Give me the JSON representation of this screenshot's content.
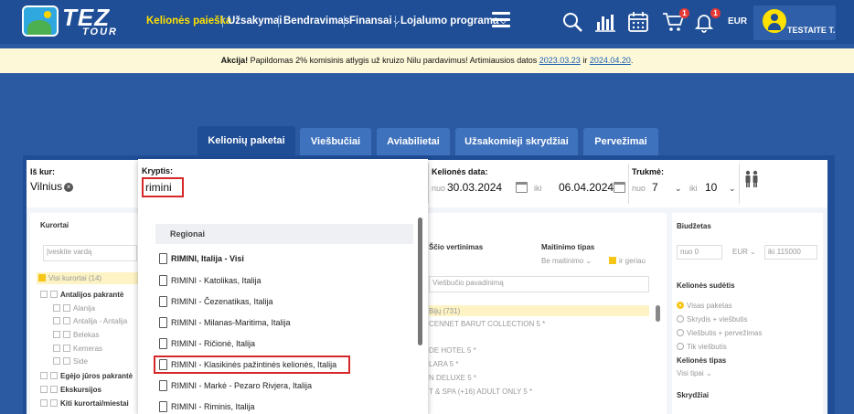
{
  "header": {
    "logo_text": "TEZ",
    "logo_sub": "TOUR",
    "nav": [
      {
        "label": "Kelionės paieška",
        "active": true
      },
      {
        "label": "Užsakymai"
      },
      {
        "label": "Bendravimas"
      },
      {
        "label": "Finansai",
        "dropdown": true
      },
      {
        "label": "Lojalumo programa",
        "dropdown": true
      }
    ],
    "icons": [
      "search-icon",
      "chart-icon",
      "calendar-icon",
      "cart-icon",
      "bell-icon"
    ],
    "cart_badge": "1",
    "bell_badge": "1",
    "currency": "EUR",
    "user_name": "TESTAITE T."
  },
  "promo": {
    "bold": "Akcija!",
    "text": " Papildomas 2% komisinis atlygis už kruizo Nilu pardavimus! Artimiausios datos ",
    "link1": "2023.03.23",
    "mid": " ir ",
    "link2": "2024.04.20",
    "end": "."
  },
  "tabs": [
    "Kelionių paketai",
    "Viešbučiai",
    "Aviabilietai",
    "Užsakomieji skrydžiai",
    "Pervežimai"
  ],
  "search": {
    "from_label": "Iš kur:",
    "from_value": "Vilnius",
    "direction_label": "Kryptis:",
    "direction_value": "rimini",
    "date_label": "Kelionės data:",
    "date_from_hint": "nuo",
    "date_from": "30.03.2024",
    "date_to_hint": "iki",
    "date_to": "06.04.2024",
    "duration_label": "Trukmė:",
    "dur_from_hint": "nuo",
    "dur_from": "7",
    "dur_to_hint": "iki",
    "dur_to": "10"
  },
  "dropdown": {
    "group": "Regionai",
    "items": [
      {
        "label": "RIMINI, Italija - Visi",
        "bold": true
      },
      {
        "label": "RIMINI - Katolikas, Italija"
      },
      {
        "label": "RIMINI - Čezenatikas, Italija"
      },
      {
        "label": "RIMINI - Milanas-Maritima, Italija"
      },
      {
        "label": "RIMINI - Ričionė, Italija"
      },
      {
        "label": "RIMINI - Klasikinės pažintinės kelionės, Italija"
      },
      {
        "label": "RIMINI - Markė - Pezaro Rivjera, Italija"
      },
      {
        "label": "RIMINI - Riminis, Italija"
      }
    ]
  },
  "left_filters": {
    "title": "Kurortai",
    "search_placeholder": "Įveskite vardą",
    "items": [
      "Visi kurortai (14)",
      "Antalijos pakrantė",
      "Alanija",
      "Antalija - Antalija",
      "Belekas",
      "Kemeras",
      "Side",
      "Egėjo jūros pakrantė",
      "Ekskursijos",
      "Kiti kurortai/miestai"
    ]
  },
  "middle": {
    "rating_label": "Ščio vertinimas",
    "meal_label": "Maitinimo tipas",
    "meal_value": "Be maitinimo",
    "better": "ir geriau",
    "hotel_placeholder": "Viešbučio pavadinimą",
    "selected": "Bijų (731)",
    "hotels": [
      "CENNET BARUT COLLECTION 5 *",
      "",
      "DE HOTEL 5 *",
      "LARA 5 *",
      "N DELUXE 5 *",
      "T & SPA (+16) ADULT ONLY 5 *"
    ]
  },
  "right": {
    "budget_label": "Biudžetas",
    "budget_from": "nuo 0",
    "budget_cur": "EUR",
    "budget_to": "iki 115000",
    "composition_label": "Kelionės sudėtis",
    "options": [
      "Visas paketas",
      "Skrydis + viešbutis",
      "Viešbutis + pervežimas",
      "Tik viešbutis"
    ],
    "type_label": "Kelionės tipas",
    "type_value": "Visi tipai",
    "flights_label": "Skrydžiai"
  }
}
